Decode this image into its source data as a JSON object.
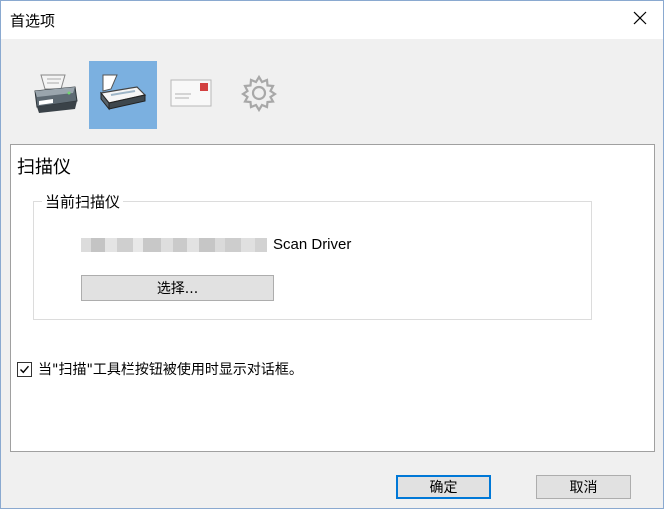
{
  "window": {
    "title": "首选项",
    "close_glyph": "✕"
  },
  "toolbar": {
    "items": [
      {
        "name": "printer",
        "icon": "printer-icon",
        "selected": false
      },
      {
        "name": "scanner",
        "icon": "scanner-icon",
        "selected": true
      },
      {
        "name": "mail",
        "icon": "envelope-icon",
        "selected": false
      },
      {
        "name": "settings",
        "icon": "gear-icon",
        "selected": false
      }
    ],
    "selected_color": "#7bb0e0"
  },
  "panel": {
    "title": "扫描仪",
    "current_scanner": {
      "legend": "当前扫描仪",
      "name_suffix": "Scan Driver",
      "select_label": "选择..."
    },
    "show_dialog": {
      "checked": true,
      "label": "当\"扫描\"工具栏按钮被使用时显示对话框。"
    }
  },
  "footer": {
    "ok_label": "确定",
    "cancel_label": "取消"
  },
  "colors": {
    "accent": "#0078d7",
    "dialog_bg": "#f0f0f0"
  }
}
